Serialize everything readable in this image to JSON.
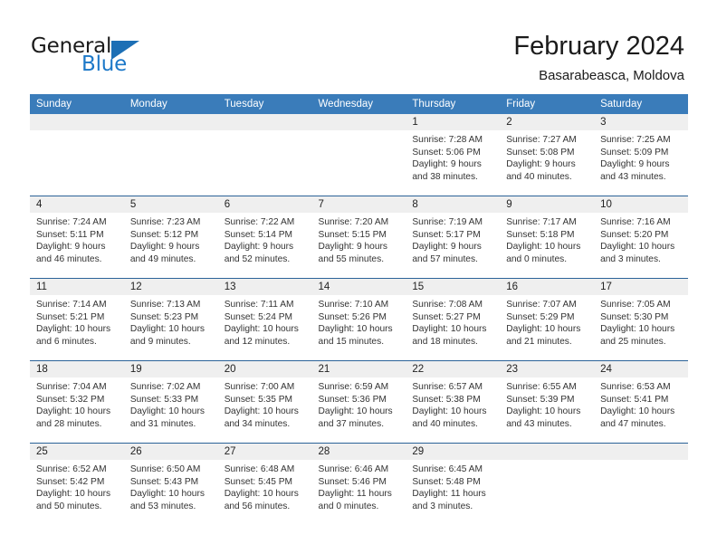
{
  "brand": {
    "name_part1": "General",
    "name_part2": "Blue"
  },
  "header": {
    "title": "February 2024",
    "subtitle": "Basarabeasca, Moldova"
  },
  "colors": {
    "header_blue": "#3a7cba",
    "row_divider_blue": "#2b6398",
    "daynum_band": "#efefef",
    "logo_blue": "#1c78c8"
  },
  "weekdays": [
    "Sunday",
    "Monday",
    "Tuesday",
    "Wednesday",
    "Thursday",
    "Friday",
    "Saturday"
  ],
  "weeks": [
    [
      {
        "day": "",
        "empty": true
      },
      {
        "day": "",
        "empty": true
      },
      {
        "day": "",
        "empty": true
      },
      {
        "day": "",
        "empty": true
      },
      {
        "day": "1",
        "sunrise": "Sunrise: 7:28 AM",
        "sunset": "Sunset: 5:06 PM",
        "daylight1": "Daylight: 9 hours",
        "daylight2": "and 38 minutes."
      },
      {
        "day": "2",
        "sunrise": "Sunrise: 7:27 AM",
        "sunset": "Sunset: 5:08 PM",
        "daylight1": "Daylight: 9 hours",
        "daylight2": "and 40 minutes."
      },
      {
        "day": "3",
        "sunrise": "Sunrise: 7:25 AM",
        "sunset": "Sunset: 5:09 PM",
        "daylight1": "Daylight: 9 hours",
        "daylight2": "and 43 minutes."
      }
    ],
    [
      {
        "day": "4",
        "sunrise": "Sunrise: 7:24 AM",
        "sunset": "Sunset: 5:11 PM",
        "daylight1": "Daylight: 9 hours",
        "daylight2": "and 46 minutes."
      },
      {
        "day": "5",
        "sunrise": "Sunrise: 7:23 AM",
        "sunset": "Sunset: 5:12 PM",
        "daylight1": "Daylight: 9 hours",
        "daylight2": "and 49 minutes."
      },
      {
        "day": "6",
        "sunrise": "Sunrise: 7:22 AM",
        "sunset": "Sunset: 5:14 PM",
        "daylight1": "Daylight: 9 hours",
        "daylight2": "and 52 minutes."
      },
      {
        "day": "7",
        "sunrise": "Sunrise: 7:20 AM",
        "sunset": "Sunset: 5:15 PM",
        "daylight1": "Daylight: 9 hours",
        "daylight2": "and 55 minutes."
      },
      {
        "day": "8",
        "sunrise": "Sunrise: 7:19 AM",
        "sunset": "Sunset: 5:17 PM",
        "daylight1": "Daylight: 9 hours",
        "daylight2": "and 57 minutes."
      },
      {
        "day": "9",
        "sunrise": "Sunrise: 7:17 AM",
        "sunset": "Sunset: 5:18 PM",
        "daylight1": "Daylight: 10 hours",
        "daylight2": "and 0 minutes."
      },
      {
        "day": "10",
        "sunrise": "Sunrise: 7:16 AM",
        "sunset": "Sunset: 5:20 PM",
        "daylight1": "Daylight: 10 hours",
        "daylight2": "and 3 minutes."
      }
    ],
    [
      {
        "day": "11",
        "sunrise": "Sunrise: 7:14 AM",
        "sunset": "Sunset: 5:21 PM",
        "daylight1": "Daylight: 10 hours",
        "daylight2": "and 6 minutes."
      },
      {
        "day": "12",
        "sunrise": "Sunrise: 7:13 AM",
        "sunset": "Sunset: 5:23 PM",
        "daylight1": "Daylight: 10 hours",
        "daylight2": "and 9 minutes."
      },
      {
        "day": "13",
        "sunrise": "Sunrise: 7:11 AM",
        "sunset": "Sunset: 5:24 PM",
        "daylight1": "Daylight: 10 hours",
        "daylight2": "and 12 minutes."
      },
      {
        "day": "14",
        "sunrise": "Sunrise: 7:10 AM",
        "sunset": "Sunset: 5:26 PM",
        "daylight1": "Daylight: 10 hours",
        "daylight2": "and 15 minutes."
      },
      {
        "day": "15",
        "sunrise": "Sunrise: 7:08 AM",
        "sunset": "Sunset: 5:27 PM",
        "daylight1": "Daylight: 10 hours",
        "daylight2": "and 18 minutes."
      },
      {
        "day": "16",
        "sunrise": "Sunrise: 7:07 AM",
        "sunset": "Sunset: 5:29 PM",
        "daylight1": "Daylight: 10 hours",
        "daylight2": "and 21 minutes."
      },
      {
        "day": "17",
        "sunrise": "Sunrise: 7:05 AM",
        "sunset": "Sunset: 5:30 PM",
        "daylight1": "Daylight: 10 hours",
        "daylight2": "and 25 minutes."
      }
    ],
    [
      {
        "day": "18",
        "sunrise": "Sunrise: 7:04 AM",
        "sunset": "Sunset: 5:32 PM",
        "daylight1": "Daylight: 10 hours",
        "daylight2": "and 28 minutes."
      },
      {
        "day": "19",
        "sunrise": "Sunrise: 7:02 AM",
        "sunset": "Sunset: 5:33 PM",
        "daylight1": "Daylight: 10 hours",
        "daylight2": "and 31 minutes."
      },
      {
        "day": "20",
        "sunrise": "Sunrise: 7:00 AM",
        "sunset": "Sunset: 5:35 PM",
        "daylight1": "Daylight: 10 hours",
        "daylight2": "and 34 minutes."
      },
      {
        "day": "21",
        "sunrise": "Sunrise: 6:59 AM",
        "sunset": "Sunset: 5:36 PM",
        "daylight1": "Daylight: 10 hours",
        "daylight2": "and 37 minutes."
      },
      {
        "day": "22",
        "sunrise": "Sunrise: 6:57 AM",
        "sunset": "Sunset: 5:38 PM",
        "daylight1": "Daylight: 10 hours",
        "daylight2": "and 40 minutes."
      },
      {
        "day": "23",
        "sunrise": "Sunrise: 6:55 AM",
        "sunset": "Sunset: 5:39 PM",
        "daylight1": "Daylight: 10 hours",
        "daylight2": "and 43 minutes."
      },
      {
        "day": "24",
        "sunrise": "Sunrise: 6:53 AM",
        "sunset": "Sunset: 5:41 PM",
        "daylight1": "Daylight: 10 hours",
        "daylight2": "and 47 minutes."
      }
    ],
    [
      {
        "day": "25",
        "sunrise": "Sunrise: 6:52 AM",
        "sunset": "Sunset: 5:42 PM",
        "daylight1": "Daylight: 10 hours",
        "daylight2": "and 50 minutes."
      },
      {
        "day": "26",
        "sunrise": "Sunrise: 6:50 AM",
        "sunset": "Sunset: 5:43 PM",
        "daylight1": "Daylight: 10 hours",
        "daylight2": "and 53 minutes."
      },
      {
        "day": "27",
        "sunrise": "Sunrise: 6:48 AM",
        "sunset": "Sunset: 5:45 PM",
        "daylight1": "Daylight: 10 hours",
        "daylight2": "and 56 minutes."
      },
      {
        "day": "28",
        "sunrise": "Sunrise: 6:46 AM",
        "sunset": "Sunset: 5:46 PM",
        "daylight1": "Daylight: 11 hours",
        "daylight2": "and 0 minutes."
      },
      {
        "day": "29",
        "sunrise": "Sunrise: 6:45 AM",
        "sunset": "Sunset: 5:48 PM",
        "daylight1": "Daylight: 11 hours",
        "daylight2": "and 3 minutes."
      },
      {
        "day": "",
        "empty": true
      },
      {
        "day": "",
        "empty": true
      }
    ]
  ]
}
